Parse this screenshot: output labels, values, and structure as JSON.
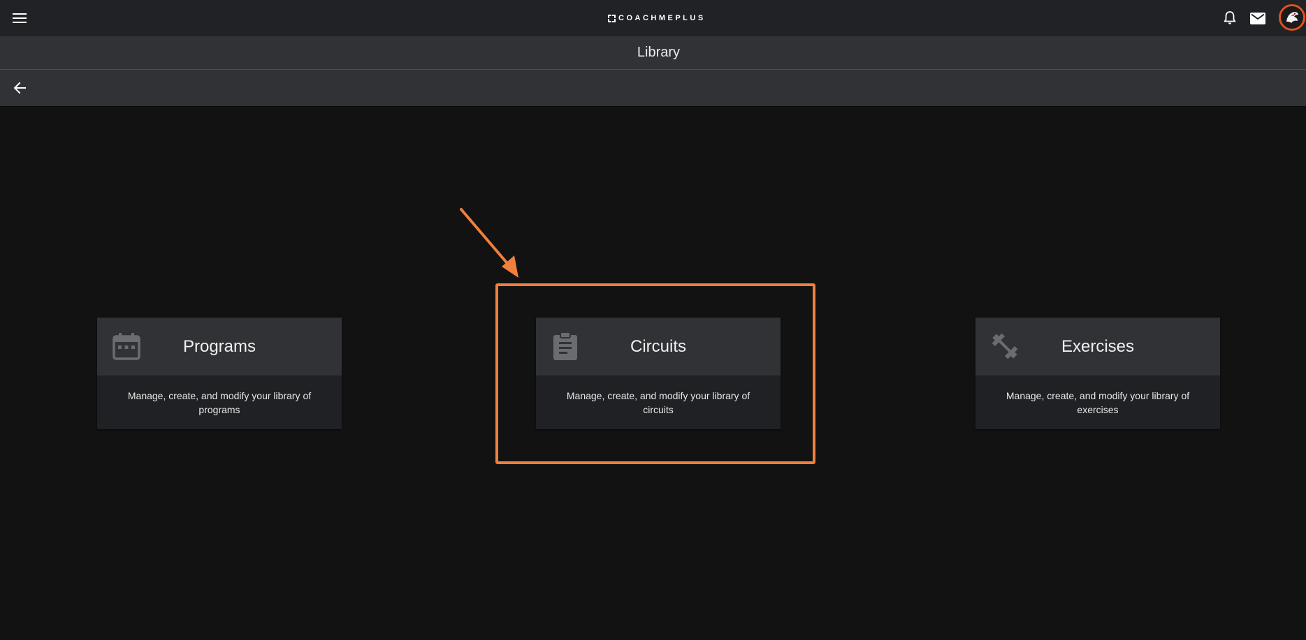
{
  "header": {
    "logo_text": "COACHMEPLUS",
    "menu_icon": "hamburger-menu-icon",
    "notifications_icon": "bell-icon",
    "messages_icon": "mail-icon",
    "avatar_icon": "team-logo-avatar"
  },
  "page": {
    "title": "Library",
    "back_icon": "arrow-left-icon"
  },
  "cards": [
    {
      "title": "Programs",
      "icon": "calendar-icon",
      "description": "Manage, create, and modify your library of programs"
    },
    {
      "title": "Circuits",
      "icon": "clipboard-icon",
      "description": "Manage, create, and modify your library of circuits"
    },
    {
      "title": "Exercises",
      "icon": "dumbbell-icon",
      "description": "Manage, create, and modify your library of exercises"
    }
  ],
  "colors": {
    "topbar": "#212225",
    "bar": "#303236",
    "background": "#121212",
    "card_body": "#202124",
    "annotation_orange": "#f0803c",
    "icon_grey": "#6b6c70"
  }
}
